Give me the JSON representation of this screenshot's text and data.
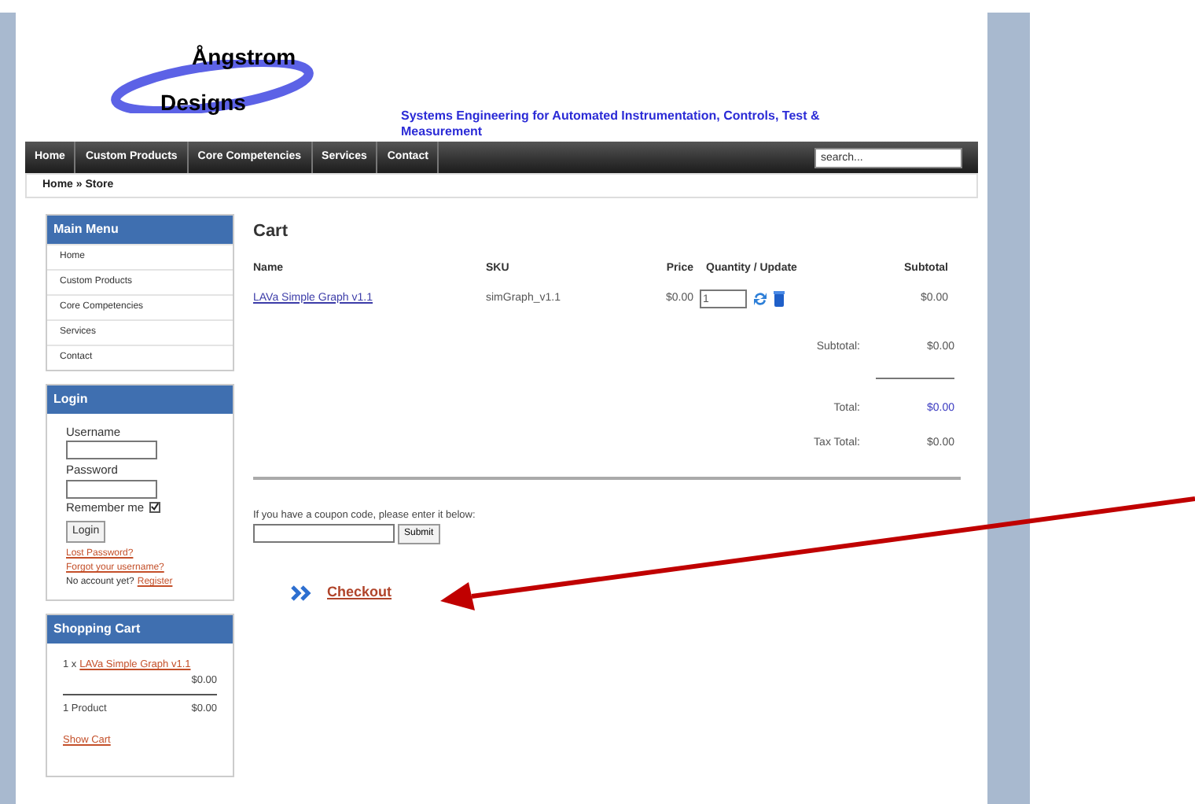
{
  "logo": {
    "line_1": "Ångstrom",
    "line_2": "Designs"
  },
  "tagline": "Systems Engineering for Automated Instrumentation, Controls, Test & Measurement",
  "nav": [
    "Home",
    "Custom Products",
    "Core Competencies",
    "Services",
    "Contact"
  ],
  "search": {
    "placeholder": "search..."
  },
  "breadcrumb": "Home » Store",
  "main_menu": {
    "title": "Main Menu",
    "items": [
      "Home",
      "Custom Products",
      "Core Competencies",
      "Services",
      "Contact"
    ]
  },
  "login": {
    "title": "Login",
    "username_label": "Username",
    "password_label": "Password",
    "remember_label": "Remember me",
    "remember_checked": true,
    "button": "Login",
    "links": [
      "Lost Password?",
      "Forgot your username?"
    ],
    "signup_text": "No account yet?",
    "signup_link": "Register"
  },
  "shopping_cart": {
    "title": "Shopping Cart",
    "item_qty": "1 x",
    "item_link": "LAVa Simple Graph v1.1",
    "item_price": "$0.00",
    "count": "1 Product",
    "total": "$0.00",
    "show_cart": "Show Cart"
  },
  "cart": {
    "title": "Cart",
    "columns": [
      "Name",
      "SKU",
      "Price",
      "Quantity / Update",
      "Subtotal"
    ],
    "rows": [
      {
        "name": "LAVa Simple Graph v1.1",
        "sku": "simGraph_v1.1",
        "price": "$0.00",
        "quantity": "1",
        "subtotal": "$0.00"
      }
    ],
    "totals": [
      {
        "label": "Subtotal:",
        "value": "$0.00",
        "emphasized": false
      },
      {
        "label": "Total:",
        "value": "$0.00",
        "emphasized": true
      },
      {
        "label": "Tax Total:",
        "value": "$0.00",
        "emphasized": false
      }
    ],
    "coupon": {
      "prompt": "If you have a coupon code, please enter it below:",
      "button": "Submit"
    },
    "checkout": "Checkout"
  }
}
